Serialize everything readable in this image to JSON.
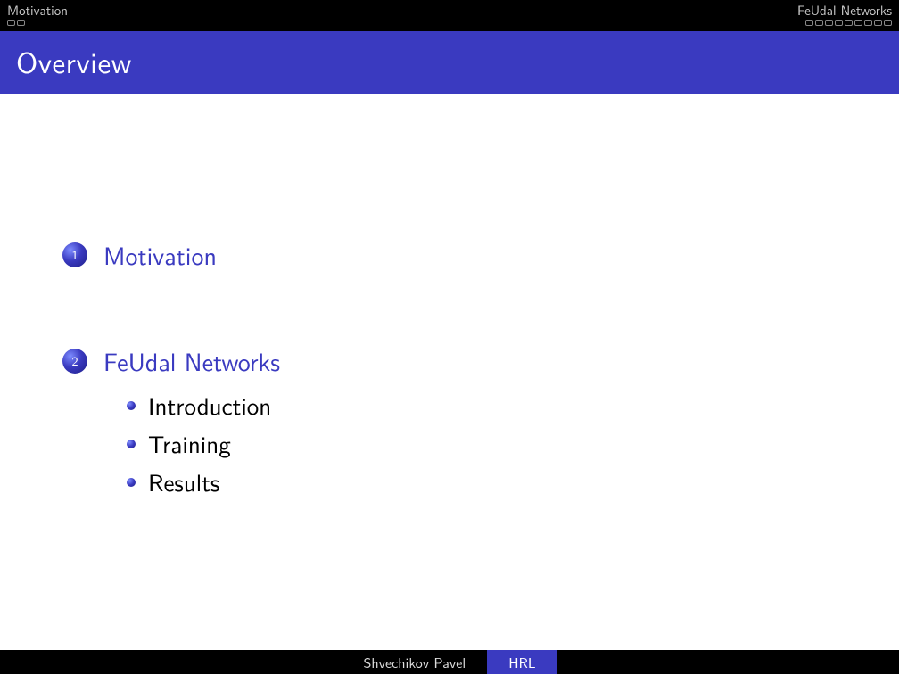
{
  "nav": {
    "left": {
      "label": "Motivation",
      "total": 2,
      "filled": 0
    },
    "right": {
      "label": "FeUdal Networks",
      "total": 9,
      "filled": 0
    }
  },
  "title": "Overview",
  "toc": [
    {
      "num": "1",
      "title": "Motivation",
      "subs": []
    },
    {
      "num": "2",
      "title": "FeUdal Networks",
      "subs": [
        "Introduction",
        "Training",
        "Results"
      ]
    }
  ],
  "footer": {
    "author": "Shvechikov Pavel",
    "short_title": "HRL"
  }
}
